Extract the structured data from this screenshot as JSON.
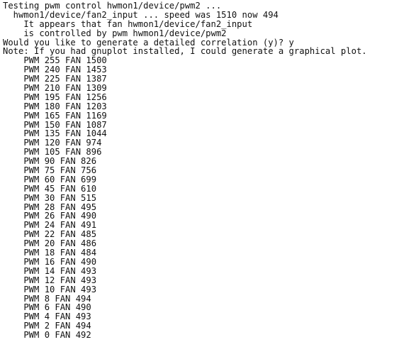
{
  "terminal": {
    "header_lines": [
      "Testing pwm control hwmon1/device/pwm2 ...",
      "  hwmon1/device/fan2_input ... speed was 1510 now 494",
      "    It appears that fan hwmon1/device/fan2_input",
      "    is controlled by pwm hwmon1/device/pwm2",
      "Would you like to generate a detailed correlation (y)? y",
      "Note: If you had gnuplot installed, I could generate a graphical plot."
    ],
    "correlation": [
      {
        "pwm": 255,
        "fan": 1500
      },
      {
        "pwm": 240,
        "fan": 1453
      },
      {
        "pwm": 225,
        "fan": 1387
      },
      {
        "pwm": 210,
        "fan": 1309
      },
      {
        "pwm": 195,
        "fan": 1256
      },
      {
        "pwm": 180,
        "fan": 1203
      },
      {
        "pwm": 165,
        "fan": 1169
      },
      {
        "pwm": 150,
        "fan": 1087
      },
      {
        "pwm": 135,
        "fan": 1044
      },
      {
        "pwm": 120,
        "fan": 974
      },
      {
        "pwm": 105,
        "fan": 896
      },
      {
        "pwm": 90,
        "fan": 826
      },
      {
        "pwm": 75,
        "fan": 756
      },
      {
        "pwm": 60,
        "fan": 699
      },
      {
        "pwm": 45,
        "fan": 610
      },
      {
        "pwm": 30,
        "fan": 515
      },
      {
        "pwm": 28,
        "fan": 495
      },
      {
        "pwm": 26,
        "fan": 490
      },
      {
        "pwm": 24,
        "fan": 491
      },
      {
        "pwm": 22,
        "fan": 485
      },
      {
        "pwm": 20,
        "fan": 486
      },
      {
        "pwm": 18,
        "fan": 484
      },
      {
        "pwm": 16,
        "fan": 490
      },
      {
        "pwm": 14,
        "fan": 493
      },
      {
        "pwm": 12,
        "fan": 493
      },
      {
        "pwm": 10,
        "fan": 493
      },
      {
        "pwm": 8,
        "fan": 494
      },
      {
        "pwm": 6,
        "fan": 490
      },
      {
        "pwm": 4,
        "fan": 493
      },
      {
        "pwm": 2,
        "fan": 494
      },
      {
        "pwm": 0,
        "fan": 492
      }
    ]
  }
}
